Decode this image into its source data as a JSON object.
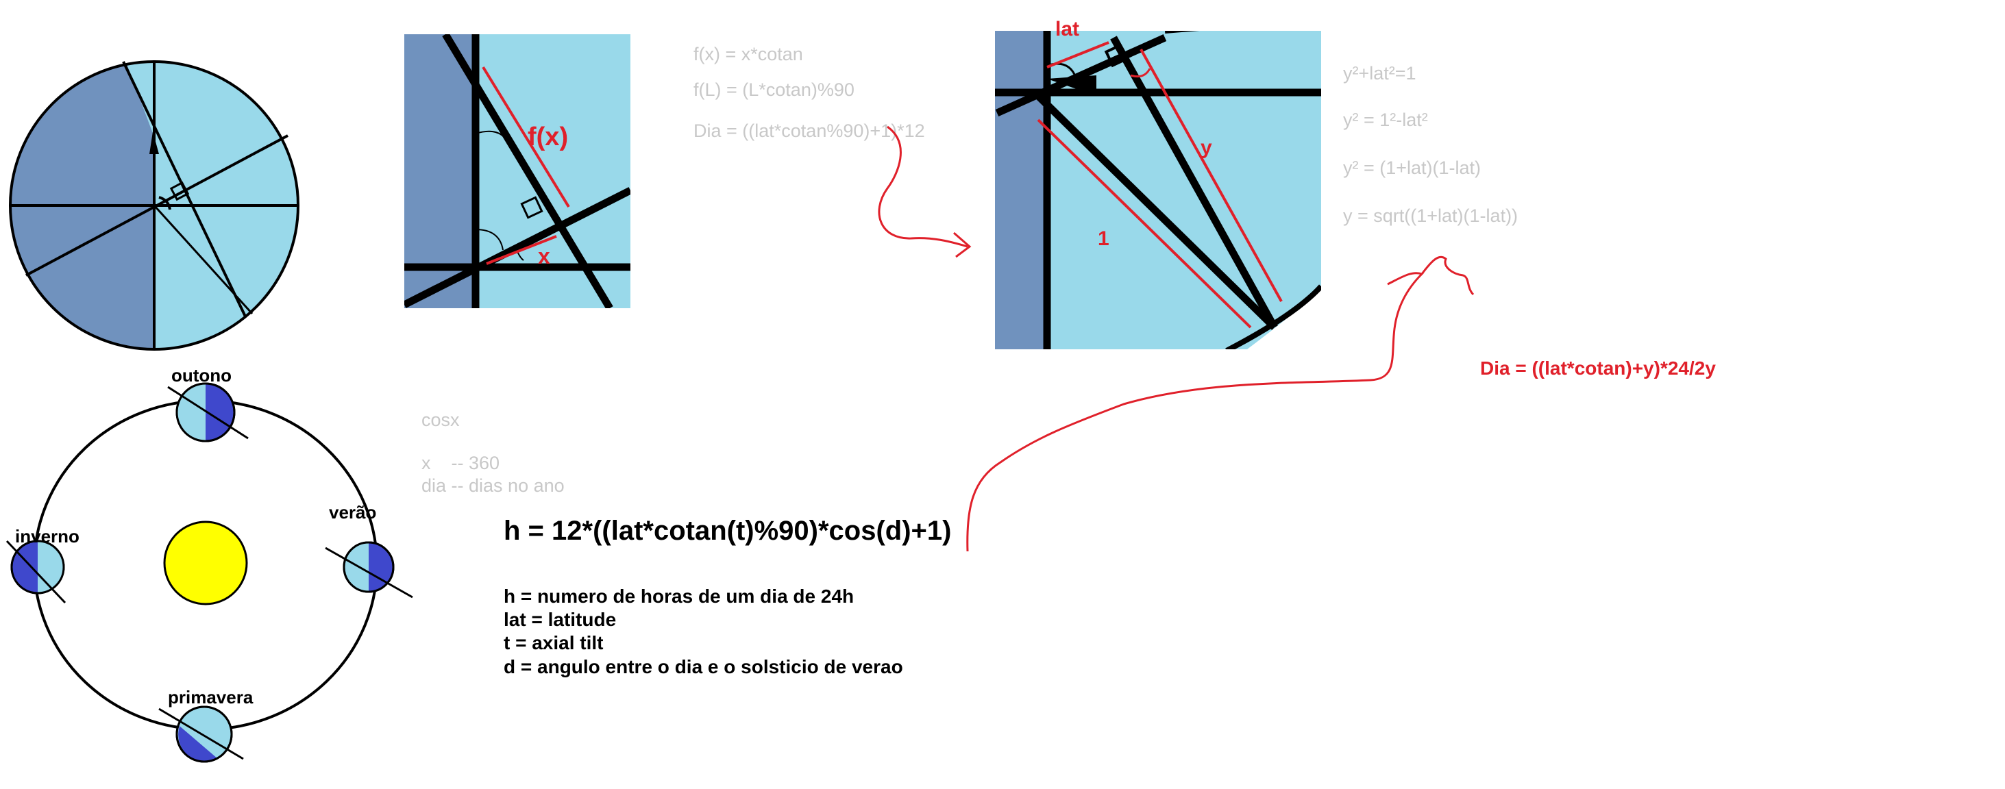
{
  "colors": {
    "dark_blue": "#7092be",
    "light_blue": "#99d9ea",
    "planet_dark": "#3f48cc",
    "sun": "#ffff00",
    "red": "#e0202a",
    "gray_text": "#c8c8c8"
  },
  "orbit": {
    "seasons": {
      "autumn": "outono",
      "summer": "verão",
      "winter": "inverno",
      "spring": "primavera"
    }
  },
  "panel1": {
    "fx_label": "f(x)",
    "x_label": "x"
  },
  "panel2": {
    "lat_label": "lat",
    "y_label": "y",
    "one_label": "1"
  },
  "formulas_top": [
    "f(x) = x*cotan",
    "f(L) = (L*cotan)%90",
    "Dia = ((lat*cotan%90)+1)*12"
  ],
  "formulas_right": [
    "y²+lat²=1",
    "y² = 1²-lat²",
    "y² = (1+lat)(1-lat)",
    "y = sqrt((1+lat)(1-lat))"
  ],
  "red_formula": "Dia = ((lat*cotan)+y)*24/2y",
  "notes": {
    "cosx": "cosx",
    "x_line": "x    -- 360",
    "dia_line": "dia -- dias no ano"
  },
  "main_formula": "h = 12*((lat*cotan(t)%90)*cos(d)+1)",
  "legend": [
    "h = numero de horas de um dia de 24h",
    "lat = latitude",
    "t = axial tilt",
    "d = angulo entre o dia e o solsticio de verao"
  ]
}
